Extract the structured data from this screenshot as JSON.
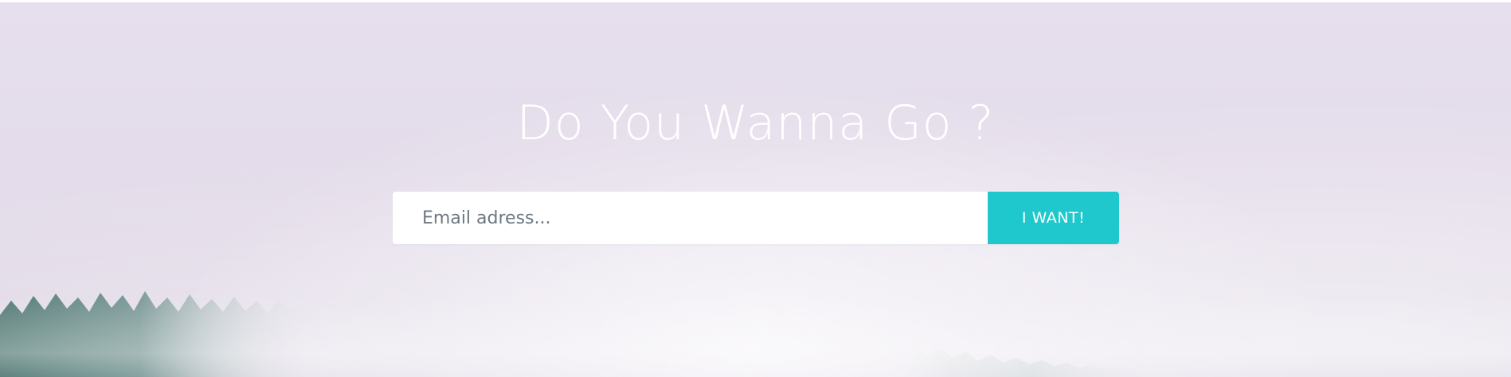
{
  "hero": {
    "title": "Do You Wanna Go ?",
    "email_placeholder": "Email adress...",
    "button_label": "I WANT!"
  },
  "colors": {
    "background": "#e5deec",
    "button": "#1ec8cc",
    "title": "#ffffff",
    "input_text": "#6c7884"
  },
  "imagery": {
    "background_scene": "misty-pine-forest"
  }
}
